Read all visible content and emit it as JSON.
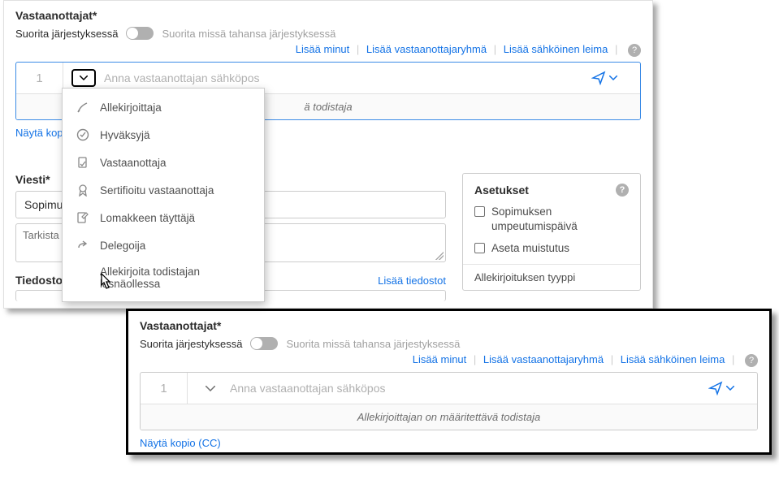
{
  "panel1": {
    "recipientsLabel": "Vastaanottajat*",
    "orderLabel": "Suorita järjestyksessä",
    "anyOrderLabel": "Suorita missä tahansa järjestyksessä",
    "links": {
      "addMe": "Lisää minut",
      "addGroup": "Lisää vastaanottajaryhmä",
      "addSeal": "Lisää sähköinen leima"
    },
    "recipNum": "1",
    "emailPlaceholder": "Anna vastaanottajan sähköpos",
    "witnessNote": "ä todistaja",
    "showCC": "Näytä kopio",
    "messageLabel": "Viesti*",
    "subject": "Sopimu",
    "body": "Tarkista ja",
    "filesLabel": "Tiedostot*",
    "addFiles": "Lisää tiedostot",
    "settings": {
      "title": "Asetukset",
      "expiry": "Sopimuksen umpeutumispäivä",
      "reminder": "Aseta muistutus",
      "sigType": "Allekirjoituksen tyyppi"
    }
  },
  "dropdown": {
    "signer": "Allekirjoittaja",
    "approver": "Hyväksyjä",
    "acceptor": "Vastaanottaja",
    "certified": "Sertifioitu vastaanottaja",
    "formFiller": "Lomakkeen täyttäjä",
    "delegator": "Delegoija",
    "witness": "Allekirjoita todistajan läsnäollessa"
  },
  "panel2": {
    "recipientsLabel": "Vastaanottajat*",
    "orderLabel": "Suorita järjestyksessä",
    "anyOrderLabel": "Suorita missä tahansa järjestyksessä",
    "links": {
      "addMe": "Lisää minut",
      "addGroup": "Lisää vastaanottajaryhmä",
      "addSeal": "Lisää sähköinen leima"
    },
    "recipNum": "1",
    "emailPlaceholder": "Anna vastaanottajan sähköpos",
    "witnessNote": "Allekirjoittajan on määritettävä todistaja",
    "showCC": "Näytä kopio (CC)"
  }
}
